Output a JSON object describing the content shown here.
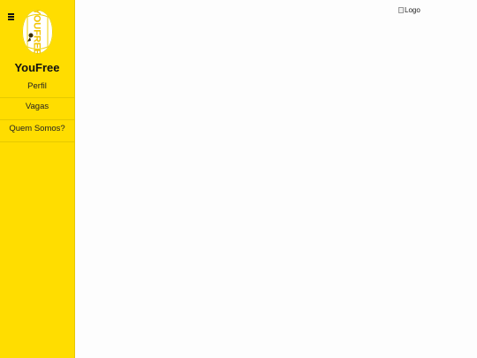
{
  "sidebar": {
    "menu_icon": "hamburger-icon",
    "logo_text": "YOUFREE",
    "brand_name": "YouFree",
    "items": [
      {
        "label": "Perfil"
      },
      {
        "label": "Vagas"
      },
      {
        "label": "Quem Somos?"
      }
    ]
  },
  "header": {
    "logo_alt": "Logo",
    "broken_image_icon": "broken-image-icon"
  },
  "colors": {
    "sidebar_bg": "#ffdd00",
    "main_bg": "#fdfdfd",
    "text": "#111111"
  }
}
